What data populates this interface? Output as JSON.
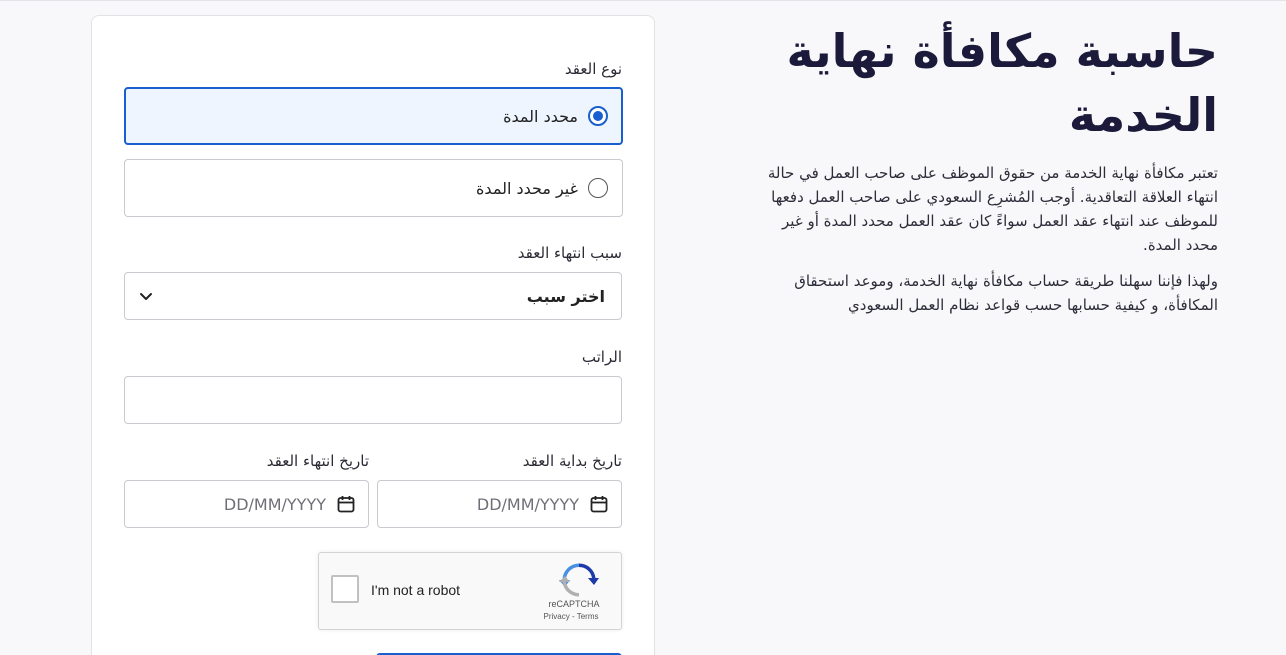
{
  "info": {
    "title": "حاسبة مكافأة نهاية الخدمة",
    "paragraph1": "تعتبر مكافأة نهاية الخدمة من حقوق الموظف على صاحب العمل في حالة انتهاء العلاقة التعاقدية. أوجب المُشرِع السعودي على صاحب العمل دفعها للموظف عند انتهاء عقد العمل سواءً كان عقد العمل محدد المدة أو غير محدد المدة.",
    "paragraph2": "ولهذا فإننا سهلنا طريقة حساب مكافأة نهاية الخدمة، وموعد استحقاق المكافأة، و كيفية حسابها حسب قواعد نظام العمل السعودي"
  },
  "form": {
    "contract_type_label": "نوع العقد",
    "contract_options": [
      {
        "label": "محدد المدة",
        "selected": true
      },
      {
        "label": "غير محدد المدة",
        "selected": false
      }
    ],
    "termination_reason_label": "سبب انتهاء العقد",
    "termination_reason_value": "اختر سبب",
    "salary_label": "الراتب",
    "salary_value": "",
    "start_date_label": "تاريخ بداية العقد",
    "start_date_placeholder": "DD/MM/YYYY",
    "end_date_label": "تاريخ انتهاء العقد",
    "end_date_placeholder": "DD/MM/YYYY"
  },
  "recaptcha": {
    "checkbox_label": "I'm not a robot",
    "brand": "reCAPTCHA",
    "privacy": "Privacy",
    "separator": " - ",
    "terms": "Terms"
  },
  "colors": {
    "accent": "#1a5fd0",
    "title": "#1b1a3a",
    "selected_bg": "#eef5ff"
  }
}
